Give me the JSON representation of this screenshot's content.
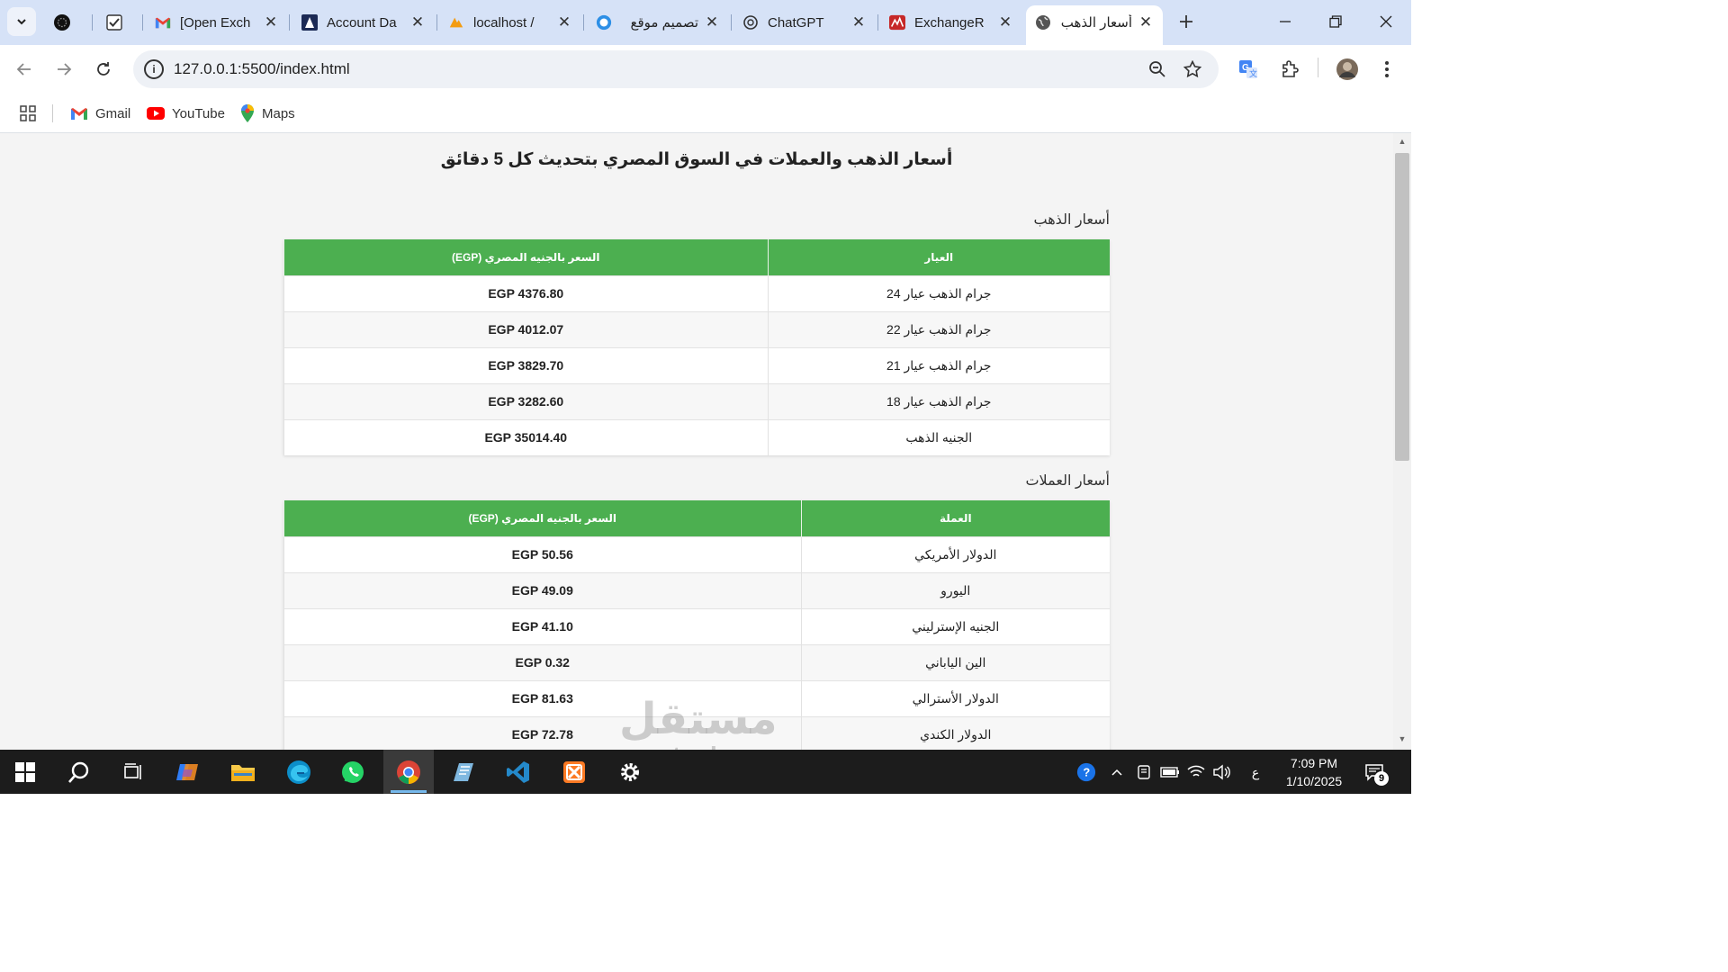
{
  "browser": {
    "tabs": [
      {
        "title": "",
        "icon": "openai-dark-icon"
      },
      {
        "title": "",
        "icon": "checkbox-icon"
      },
      {
        "title": "[Open Exch",
        "icon": "gmail-icon"
      },
      {
        "title": "Account Da",
        "icon": "account-icon"
      },
      {
        "title": "localhost / ",
        "icon": "phpmyadmin-icon"
      },
      {
        "title": "تصميم موقع",
        "icon": "circle-blue-icon"
      },
      {
        "title": "ChatGPT",
        "icon": "chatgpt-icon"
      },
      {
        "title": "ExchangeR",
        "icon": "exchangerate-icon"
      },
      {
        "title": "أسعار الذهب",
        "icon": "globe-icon"
      }
    ],
    "address_bar": {
      "url": "127.0.0.1:5500/index.html"
    },
    "bookmarks": [
      {
        "label": "Gmail",
        "icon": "gmail-icon"
      },
      {
        "label": "YouTube",
        "icon": "youtube-icon"
      },
      {
        "label": "Maps",
        "icon": "maps-icon"
      }
    ]
  },
  "page": {
    "title": "أسعار الذهب والعملات في السوق المصري بتحديث كل 5 دقائق",
    "gold": {
      "heading": "أسعار الذهب",
      "columns": [
        "العيار",
        "السعر بالجنيه المصري (EGP)"
      ],
      "rows": [
        {
          "name": "جرام الذهب عيار 24",
          "price": "EGP 4376.80"
        },
        {
          "name": "جرام الذهب عيار 22",
          "price": "EGP 4012.07"
        },
        {
          "name": "جرام الذهب عيار 21",
          "price": "EGP 3829.70"
        },
        {
          "name": "جرام الذهب عيار 18",
          "price": "EGP 3282.60"
        },
        {
          "name": "الجنيه الذهب",
          "price": "EGP 35014.40"
        }
      ]
    },
    "currencies": {
      "heading": "أسعار العملات",
      "columns": [
        "العملة",
        "السعر بالجنيه المصري (EGP)"
      ],
      "rows": [
        {
          "name": "الدولار الأمريكي",
          "price": "EGP 50.56"
        },
        {
          "name": "اليورو",
          "price": "EGP 49.09"
        },
        {
          "name": "الجنيه الإسترليني",
          "price": "EGP 41.10"
        },
        {
          "name": "الين الياباني",
          "price": "EGP 0.32"
        },
        {
          "name": "الدولار الأسترالي",
          "price": "EGP 81.63"
        },
        {
          "name": "الدولار الكندي",
          "price": "EGP 72.78"
        }
      ]
    },
    "colors": {
      "header_green": "#4caf50",
      "gold_price": "#d9453a",
      "currency_price": "#1d6fb8"
    }
  },
  "watermark": {
    "arabic": "مستقل",
    "latin": "mostaql.com"
  },
  "taskbar": {
    "apps": [
      "windows-start-icon",
      "search-icon",
      "task-view-icon",
      "copilot-icon",
      "file-explorer-icon",
      "edge-icon",
      "whatsapp-icon",
      "chrome-icon",
      "notepad-icon",
      "vscode-icon",
      "xampp-icon",
      "settings-icon"
    ],
    "lang": "ع",
    "time": "7:09 PM",
    "date": "1/10/2025",
    "notifications": "9"
  }
}
